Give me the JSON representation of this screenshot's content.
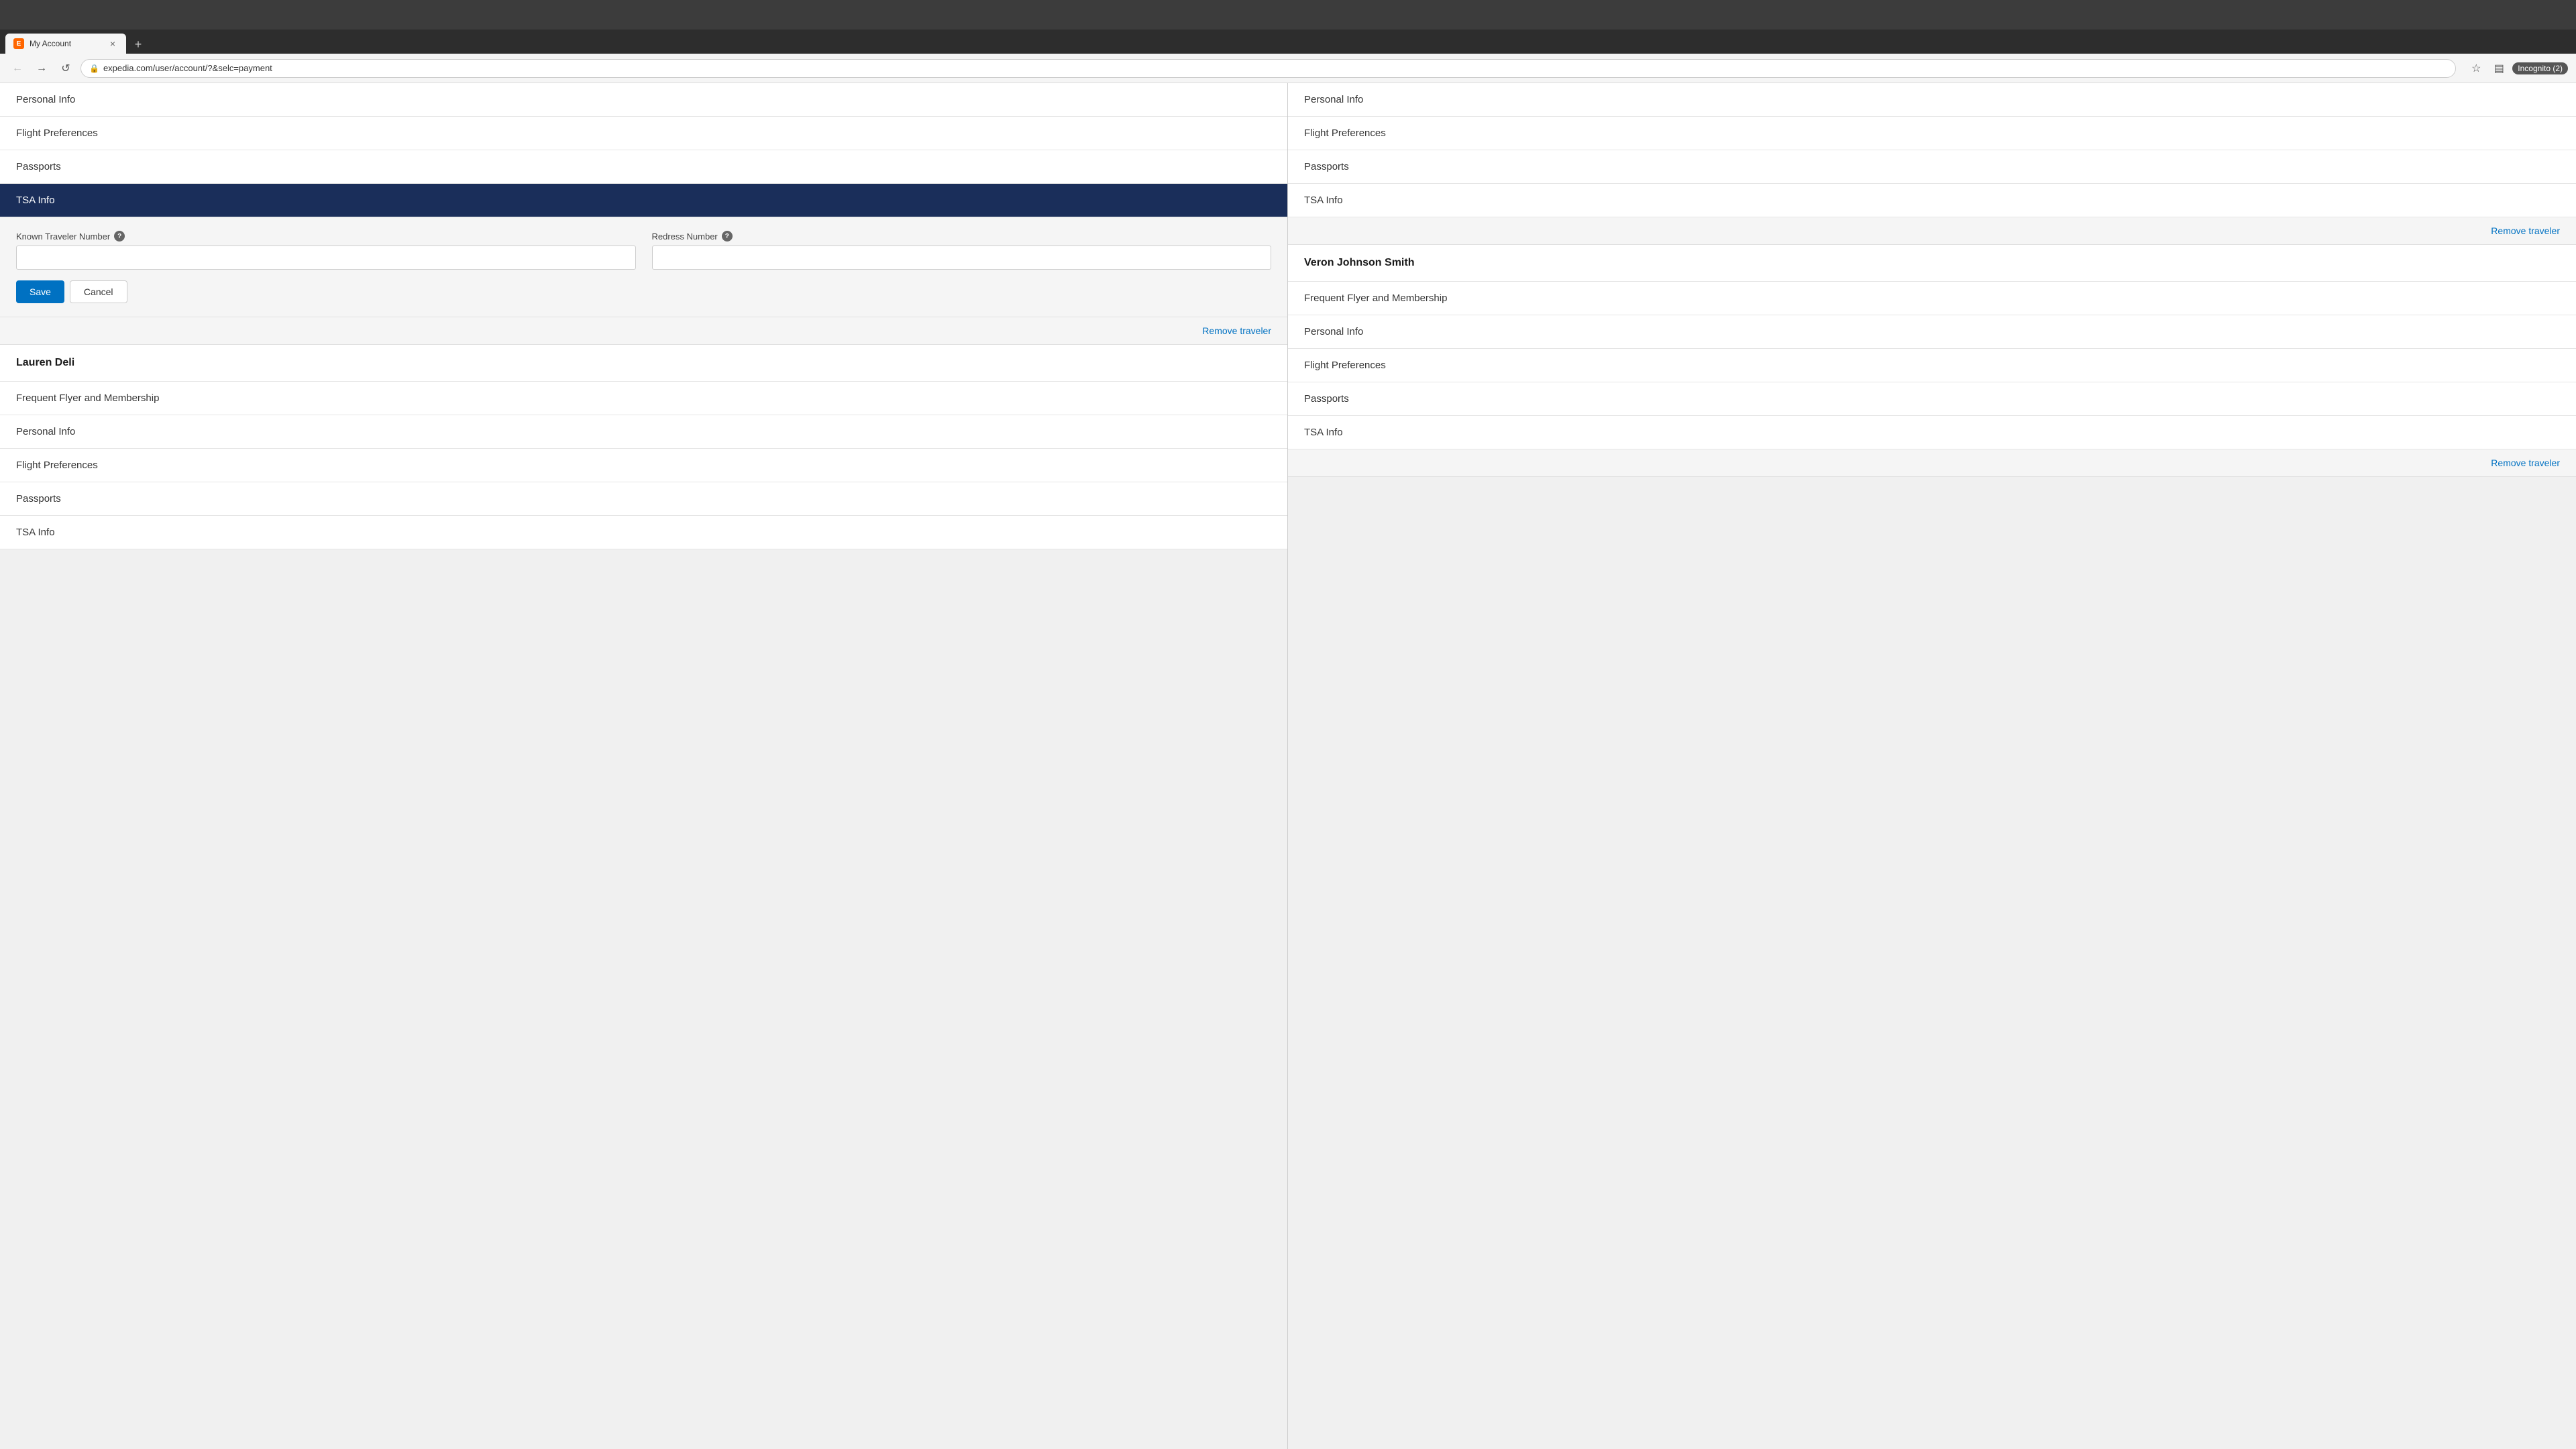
{
  "browser": {
    "tab_title": "My Account",
    "tab_icon_text": "E",
    "address_url": "expedia.com/user/account/?&selc=payment",
    "incognito_label": "Incognito (2)"
  },
  "left_column": {
    "nav_items": [
      {
        "id": "personal-info-left",
        "label": "Personal Info",
        "active": false
      },
      {
        "id": "flight-prefs-left",
        "label": "Flight Preferences",
        "active": false
      },
      {
        "id": "passports-left",
        "label": "Passports",
        "active": false
      },
      {
        "id": "tsa-info-left",
        "label": "TSA Info",
        "active": true
      }
    ],
    "tsa_form": {
      "known_traveler_label": "Known Traveler Number",
      "redress_label": "Redress Number",
      "known_traveler_placeholder": "",
      "redress_placeholder": "",
      "save_label": "Save",
      "cancel_label": "Cancel"
    },
    "remove_traveler_link": "Remove traveler",
    "lauren_section": {
      "heading": "Lauren Deli",
      "nav_items": [
        {
          "id": "ff-lauren",
          "label": "Frequent Flyer and Membership"
        },
        {
          "id": "pi-lauren",
          "label": "Personal Info"
        },
        {
          "id": "fp-lauren",
          "label": "Flight Preferences"
        },
        {
          "id": "pass-lauren",
          "label": "Passports"
        },
        {
          "id": "tsa-lauren",
          "label": "TSA Info"
        }
      ]
    }
  },
  "right_column": {
    "top_nav_items": [
      {
        "id": "personal-info-right",
        "label": "Personal Info"
      },
      {
        "id": "flight-prefs-right",
        "label": "Flight Preferences"
      },
      {
        "id": "passports-right",
        "label": "Passports"
      },
      {
        "id": "tsa-info-right",
        "label": "TSA Info"
      }
    ],
    "remove_traveler_link": "Remove traveler",
    "veron_section": {
      "heading": "Veron Johnson Smith",
      "nav_items": [
        {
          "id": "ff-veron",
          "label": "Frequent Flyer and Membership"
        },
        {
          "id": "pi-veron",
          "label": "Personal Info"
        },
        {
          "id": "fp-veron",
          "label": "Flight Preferences"
        },
        {
          "id": "pass-veron",
          "label": "Passports"
        },
        {
          "id": "tsa-veron",
          "label": "TSA Info"
        }
      ]
    },
    "remove_traveler_link2": "Remove traveler"
  },
  "icons": {
    "back": "←",
    "forward": "→",
    "reload": "↺",
    "lock": "🔒",
    "star": "☆",
    "profile": "👤",
    "close": "×",
    "plus": "+",
    "help": "?"
  }
}
